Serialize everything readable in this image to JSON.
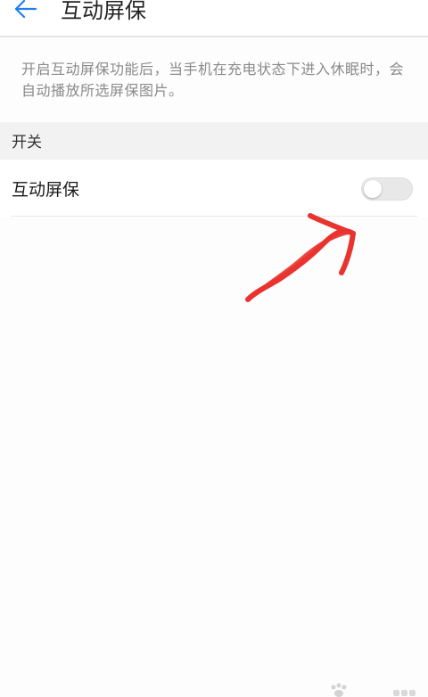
{
  "header": {
    "title": "互动屏保",
    "back_icon": "back-arrow-icon",
    "accent_color": "#1f7ff0"
  },
  "description": "开启互动屏保功能后，当手机在充电状态下进入休眠时，会自动播放所选屏保图片。",
  "section": {
    "title": "开关"
  },
  "setting": {
    "label": "互动屏保",
    "toggle_state": "off"
  },
  "annotation": {
    "type": "hand-drawn-arrow",
    "color": "#e8332f"
  }
}
